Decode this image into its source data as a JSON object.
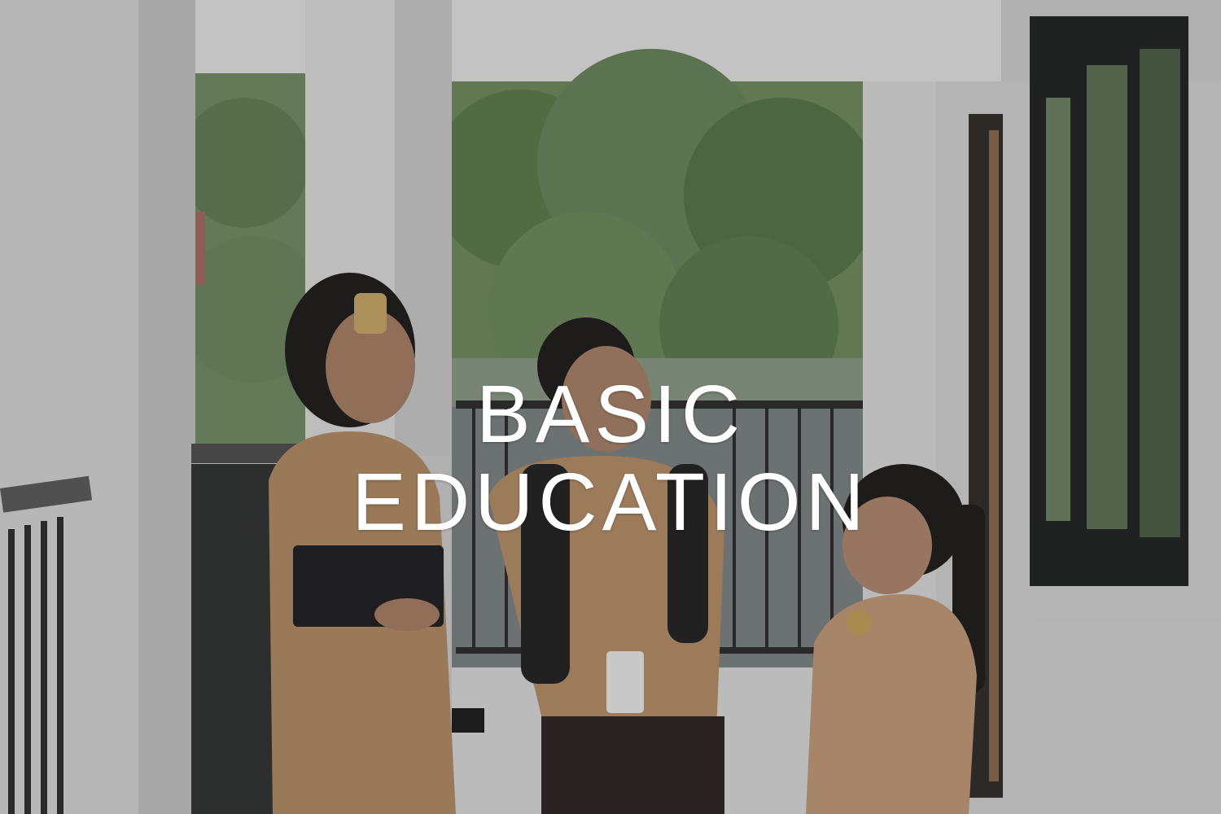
{
  "headline": {
    "line1": "BASIC",
    "line2": "EDUCATION"
  },
  "colors": {
    "text": "#ffffff",
    "uniform": "#b08a63",
    "wall": "#d9d9d9",
    "foliage": "#5e7a4e"
  }
}
